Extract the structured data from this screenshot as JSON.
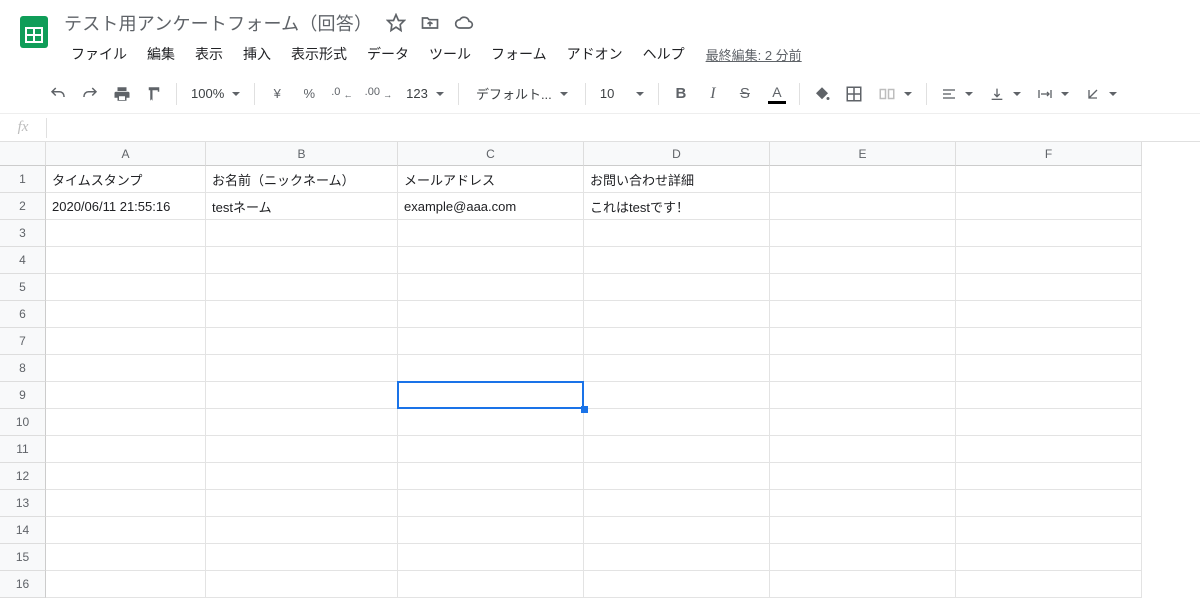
{
  "docTitle": "テスト用アンケートフォーム（回答）",
  "menus": [
    "ファイル",
    "編集",
    "表示",
    "挿入",
    "表示形式",
    "データ",
    "ツール",
    "フォーム",
    "アドオン",
    "ヘルプ"
  ],
  "lastEdit": "最終編集: 2 分前",
  "toolbar": {
    "zoom": "100%",
    "currency": "¥",
    "percent": "%",
    "decDown": ".0",
    "decUp": ".00",
    "fmt": "123",
    "font": "デフォルト...",
    "fontSize": "10",
    "bold": "B",
    "italic": "I",
    "strike": "S",
    "textColor": "A"
  },
  "fx": "fx",
  "columns": [
    "A",
    "B",
    "C",
    "D",
    "E",
    "F"
  ],
  "rowCount": 16,
  "sheet": {
    "r1": {
      "A": "タイムスタンプ",
      "B": "お名前（ニックネーム）",
      "C": "メールアドレス",
      "D": "お問い合わせ詳細"
    },
    "r2": {
      "A": "2020/06/11 21:55:16",
      "B": "testネーム",
      "C": "example@aaa.com",
      "D": "これはtestです！"
    }
  },
  "selection": {
    "col": "C",
    "row": 9
  }
}
